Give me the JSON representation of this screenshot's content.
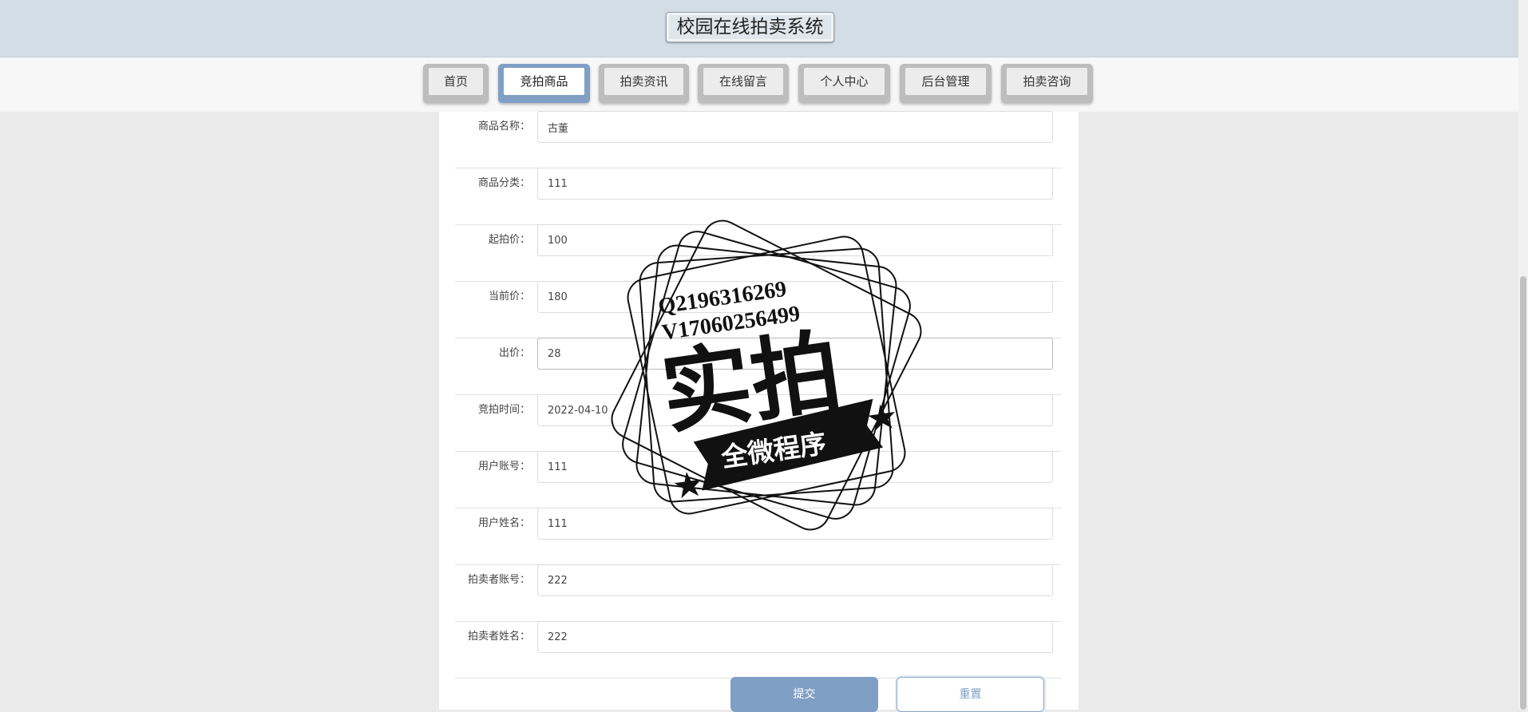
{
  "header": {
    "title": "校园在线拍卖系统"
  },
  "nav": {
    "tabs": [
      {
        "label": "首页",
        "active": false
      },
      {
        "label": "竞拍商品",
        "active": true
      },
      {
        "label": "拍卖资讯",
        "active": false
      },
      {
        "label": "在线留言",
        "active": false
      },
      {
        "label": "个人中心",
        "active": false
      },
      {
        "label": "后台管理",
        "active": false
      },
      {
        "label": "拍卖咨询",
        "active": false
      }
    ]
  },
  "form": {
    "fields": [
      {
        "label": "商品名称：",
        "value": "古董"
      },
      {
        "label": "商品分类：",
        "value": "111"
      },
      {
        "label": "起拍价：",
        "value": "100"
      },
      {
        "label": "当前价：",
        "value": "180"
      },
      {
        "label": "出价：",
        "value": "28"
      },
      {
        "label": "竞拍时间：",
        "value": "2022-04-10"
      },
      {
        "label": "用户账号：",
        "value": "111"
      },
      {
        "label": "用户姓名：",
        "value": "111"
      },
      {
        "label": "拍卖者账号：",
        "value": "222"
      },
      {
        "label": "拍卖者姓名：",
        "value": "222"
      }
    ],
    "submit_label": "提交",
    "reset_label": "重置"
  },
  "watermark": {
    "line1": "Q2196316269",
    "line2": "V17060256499",
    "big_text": "实拍",
    "banner_text": "全微程序"
  },
  "colors": {
    "accent": "#7f9fc5",
    "header_bg": "#d2dde6",
    "page_bg": "#eaeaea"
  }
}
